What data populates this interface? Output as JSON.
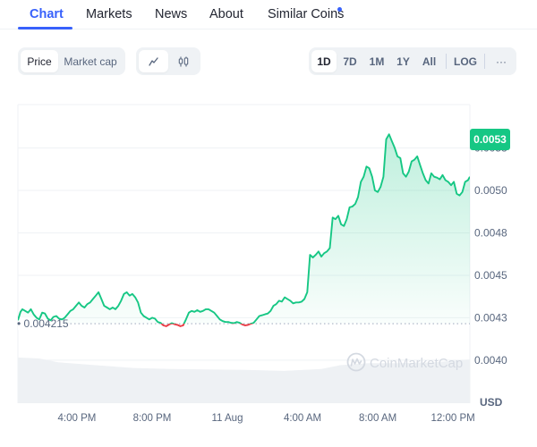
{
  "tabs": [
    {
      "label": "Chart",
      "active": true
    },
    {
      "label": "Markets",
      "active": false
    },
    {
      "label": "News",
      "active": false
    },
    {
      "label": "About",
      "active": false
    },
    {
      "label": "Similar Coins",
      "active": false,
      "notification_dot": true
    }
  ],
  "toolbar": {
    "data_type": {
      "options": [
        "Price",
        "Market cap"
      ],
      "selected": "Price"
    },
    "chart_type": {
      "options": [
        {
          "icon": "line-chart-icon",
          "label": "Line"
        },
        {
          "icon": "candlestick-icon",
          "label": "Candles"
        }
      ],
      "selected": "line-chart-icon"
    },
    "ranges": {
      "options": [
        "1D",
        "7D",
        "1M",
        "1Y",
        "All"
      ],
      "selected": "1D"
    },
    "log_label": "LOG",
    "more_label": "···"
  },
  "colors": {
    "accent": "#3861fb",
    "up": "#16c784",
    "down": "#ea3943",
    "grid": "#eff2f5",
    "axis_text": "#58667e",
    "volume": "#eff2f5"
  },
  "watermark": "CoinMarketCap",
  "chart_data": {
    "type": "area",
    "title": "",
    "xlabel": "",
    "ylabel": "USD",
    "currency_label": "USD",
    "x_unit": "hours since 12:00 PM (10 Aug)",
    "x_ticks": [
      {
        "value": 4,
        "label": "4:00 PM"
      },
      {
        "value": 8,
        "label": "8:00 PM"
      },
      {
        "value": 12,
        "label": "11 Aug"
      },
      {
        "value": 16,
        "label": "4:00 AM"
      },
      {
        "value": 20,
        "label": "8:00 AM"
      },
      {
        "value": 24,
        "label": "12:00 PM"
      }
    ],
    "y_ticks": [
      {
        "value": 0.00525,
        "label": "0.0053"
      },
      {
        "value": 0.005,
        "label": "0.0050"
      },
      {
        "value": 0.00475,
        "label": "0.0048"
      },
      {
        "value": 0.0045,
        "label": "0.0045"
      },
      {
        "value": 0.00425,
        "label": "0.0043"
      },
      {
        "value": 0.004,
        "label": "0.0040"
      }
    ],
    "xlim": [
      0.86,
      24.9
    ],
    "ylim": [
      0.003747,
      0.005505
    ],
    "grid": true,
    "reference_price": {
      "value": 0.004215,
      "label": "0.004215"
    },
    "current_price": {
      "value": 0.0053,
      "label": "0.0053"
    },
    "series": [
      {
        "name": "Price",
        "x": [
          0.86,
          1.0,
          1.1,
          1.25,
          1.4,
          1.55,
          1.7,
          1.85,
          2.0,
          2.15,
          2.3,
          2.45,
          2.6,
          2.75,
          2.9,
          3.05,
          3.2,
          3.35,
          3.5,
          3.65,
          3.8,
          3.95,
          4.1,
          4.25,
          4.4,
          4.55,
          4.7,
          4.85,
          5.0,
          5.15,
          5.3,
          5.45,
          5.6,
          5.75,
          5.9,
          6.05,
          6.2,
          6.35,
          6.5,
          6.65,
          6.8,
          6.95,
          7.1,
          7.25,
          7.4,
          7.55,
          7.7,
          7.85,
          8.0,
          8.15,
          8.3,
          8.45,
          8.6,
          8.75,
          8.9,
          9.05,
          9.2,
          9.35,
          9.5,
          9.65,
          9.8,
          9.95,
          10.1,
          10.25,
          10.4,
          10.55,
          10.7,
          10.85,
          11.0,
          11.15,
          11.3,
          11.45,
          11.6,
          11.75,
          11.9,
          12.05,
          12.2,
          12.35,
          12.5,
          12.65,
          12.8,
          12.95,
          13.1,
          13.25,
          13.4,
          13.55,
          13.7,
          13.85,
          14.0,
          14.15,
          14.3,
          14.45,
          14.6,
          14.75,
          14.9,
          15.05,
          15.2,
          15.35,
          15.5,
          15.65,
          15.8,
          15.95,
          16.1,
          16.25,
          16.4,
          16.55,
          16.7,
          16.85,
          17.0,
          17.15,
          17.3,
          17.45,
          17.6,
          17.75,
          17.9,
          18.05,
          18.2,
          18.35,
          18.5,
          18.65,
          18.8,
          18.95,
          19.1,
          19.25,
          19.4,
          19.55,
          19.7,
          19.85,
          20.0,
          20.15,
          20.3,
          20.45,
          20.6,
          20.75,
          20.9,
          21.05,
          21.2,
          21.35,
          21.5,
          21.65,
          21.8,
          21.95,
          22.1,
          22.25,
          22.4,
          22.55,
          22.7,
          22.85,
          23.0,
          23.15,
          23.3,
          23.45,
          23.6,
          23.75,
          23.9,
          24.05,
          24.2,
          24.35,
          24.5,
          24.65,
          24.8,
          24.9
        ],
        "values": [
          0.004235,
          0.004285,
          0.0043,
          0.00429,
          0.00428,
          0.0043,
          0.00427,
          0.00425,
          0.00424,
          0.00428,
          0.004275,
          0.004245,
          0.004235,
          0.004255,
          0.00426,
          0.004245,
          0.00424,
          0.00425,
          0.00427,
          0.00429,
          0.0043,
          0.00432,
          0.00434,
          0.00432,
          0.00431,
          0.00433,
          0.00434,
          0.00436,
          0.00438,
          0.0044,
          0.00436,
          0.00432,
          0.00431,
          0.0043,
          0.00431,
          0.0043,
          0.00432,
          0.00435,
          0.00439,
          0.0044,
          0.00438,
          0.00439,
          0.00437,
          0.00434,
          0.00428,
          0.00426,
          0.00425,
          0.00424,
          0.00425,
          0.004245,
          0.004225,
          0.00422,
          0.004205,
          0.0042,
          0.00421,
          0.004218,
          0.004212,
          0.004208,
          0.0042,
          0.004205,
          0.00424,
          0.00428,
          0.00429,
          0.004285,
          0.004295,
          0.004285,
          0.00429,
          0.0043,
          0.0043,
          0.00429,
          0.00428,
          0.00426,
          0.00424,
          0.00423,
          0.004225,
          0.004225,
          0.00422,
          0.004218,
          0.004225,
          0.00422,
          0.00421,
          0.004205,
          0.004208,
          0.004215,
          0.00422,
          0.00424,
          0.00426,
          0.004265,
          0.00427,
          0.004275,
          0.00429,
          0.00432,
          0.00433,
          0.00435,
          0.004345,
          0.00437,
          0.00436,
          0.00435,
          0.004335,
          0.00434,
          0.00434,
          0.004345,
          0.00436,
          0.0044,
          0.00462,
          0.004605,
          0.00462,
          0.00464,
          0.00461,
          0.00463,
          0.00464,
          0.00466,
          0.00484,
          0.00483,
          0.00485,
          0.0048,
          0.00479,
          0.00483,
          0.0049,
          0.004905,
          0.00492,
          0.00496,
          0.00505,
          0.00508,
          0.00514,
          0.00513,
          0.00508,
          0.005,
          0.00499,
          0.00502,
          0.00508,
          0.0053,
          0.00533,
          0.00529,
          0.00525,
          0.0052,
          0.00519,
          0.0051,
          0.00508,
          0.00511,
          0.00517,
          0.00518,
          0.0052,
          0.00515,
          0.0051,
          0.00506,
          0.00504,
          0.0051,
          0.00508,
          0.005075,
          0.005065,
          0.00509,
          0.00506,
          0.00505,
          0.00503,
          0.00505,
          0.00498,
          0.00497,
          0.00499,
          0.00505,
          0.00506,
          0.00508,
          0.00511,
          0.00513,
          0.00515,
          0.00516,
          0.00517,
          0.00511,
          0.0051,
          0.00513,
          0.00516,
          0.0052,
          0.0053
        ]
      }
    ],
    "volume_series": {
      "name": "Volume",
      "x": [
        0.86,
        2.0,
        3.0,
        5.0,
        7.0,
        9.0,
        11.0,
        13.0,
        15.0,
        17.0,
        18.0,
        19.5,
        21.0,
        23.0,
        24.9
      ],
      "relative_values": [
        0.96,
        0.94,
        0.86,
        0.8,
        0.74,
        0.72,
        0.71,
        0.7,
        0.68,
        0.72,
        0.8,
        0.84,
        0.84,
        0.86,
        0.92
      ]
    }
  }
}
